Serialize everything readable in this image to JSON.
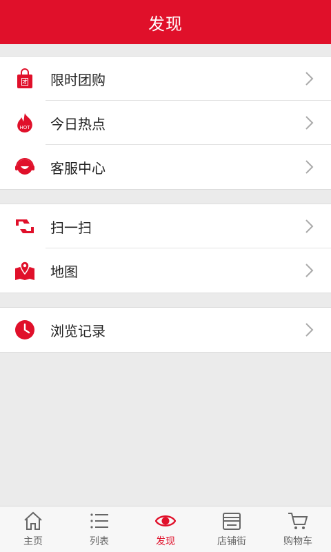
{
  "header": {
    "title": "发现"
  },
  "groups": [
    {
      "items": [
        {
          "label": "限时团购",
          "icon": "shopping-bag-icon"
        },
        {
          "label": "今日热点",
          "icon": "hot-flame-icon"
        },
        {
          "label": "客服中心",
          "icon": "customer-service-icon"
        }
      ]
    },
    {
      "items": [
        {
          "label": "扫一扫",
          "icon": "scan-icon"
        },
        {
          "label": "地图",
          "icon": "map-icon"
        }
      ]
    },
    {
      "items": [
        {
          "label": "浏览记录",
          "icon": "clock-icon"
        }
      ]
    }
  ],
  "icons": {
    "bag_badge": "团",
    "hot_badge": "HOT"
  },
  "tabbar": {
    "tabs": [
      {
        "label": "主页",
        "icon": "home-icon"
      },
      {
        "label": "列表",
        "icon": "list-icon"
      },
      {
        "label": "发现",
        "icon": "eye-icon",
        "active": true
      },
      {
        "label": "店铺街",
        "icon": "store-icon"
      },
      {
        "label": "购物车",
        "icon": "cart-icon"
      }
    ]
  },
  "colors": {
    "accent": "#e0102a",
    "background": "#ebebeb"
  }
}
